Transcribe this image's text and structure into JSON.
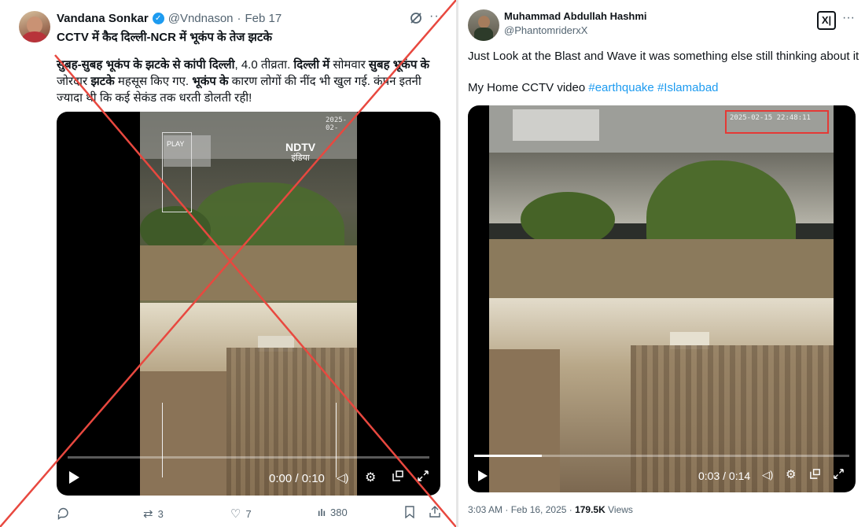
{
  "left_tweet": {
    "author_name": "Vandana Sonkar",
    "author_handle": "@Vndnason",
    "date": "Feb 17",
    "headline": "CCTV में कैद दिल्ली-NCR में भूकंप के तेज झटके",
    "body_segments": [
      {
        "text": "सुबह-सुबह भूकंप के झटके से कांपी दिल्ली",
        "bold": true
      },
      {
        "text": ", 4.0 तीव्रता. ",
        "bold": false
      },
      {
        "text": "दिल्ली में",
        "bold": true
      },
      {
        "text": " सोमवार ",
        "bold": false
      },
      {
        "text": "सुबह भूकंप के",
        "bold": true
      },
      {
        "text": " जोरदार ",
        "bold": false
      },
      {
        "text": "झटके",
        "bold": true
      },
      {
        "text": " महसूस किए गए. ",
        "bold": false
      },
      {
        "text": "भूकंप के",
        "bold": true
      },
      {
        "text": " कारण लोगों की नींद भी खुल गई. कंपन इतनी ज्यादा थी कि कई सेकंड तक धरती डोलती रही!",
        "bold": false
      }
    ],
    "video_time": "0:00 / 0:10",
    "video_overlay": {
      "play_label": "PLAY",
      "channel_logo": "NDTV",
      "channel_sub": "इंडिया",
      "timestamp": "2025-02-"
    },
    "actions": {
      "replies": "",
      "reposts": "3",
      "likes": "7",
      "views": "380"
    },
    "icons": [
      "verified-badge-icon",
      "grok-icon",
      "more-icon",
      "play-icon",
      "volume-icon",
      "settings-icon",
      "pip-icon",
      "fullscreen-icon",
      "reply-icon",
      "repost-icon",
      "like-icon",
      "views-icon",
      "bookmark-icon",
      "share-icon"
    ]
  },
  "right_tweet": {
    "author_name": "Muhammad Abdullah Hashmi",
    "author_handle": "@PhantomriderxX",
    "text_line1": "Just Look at the Blast and Wave it was something else still thinking about it",
    "text_line2_prefix": "My Home CCTV video ",
    "hashtags": [
      "#earthquake",
      "#Islamabad"
    ],
    "video_time": "0:03 / 0:14",
    "cctv_timestamp": "2025-02-15 22:48:11",
    "footer_time": "3:03 AM · Feb 16, 2025 · ",
    "views_count": "179.5K",
    "views_label": " Views",
    "icons": [
      "x-logo-icon",
      "more-icon",
      "play-icon",
      "volume-icon",
      "settings-icon",
      "pip-icon",
      "fullscreen-icon"
    ]
  },
  "colors": {
    "cross": "#e8483f",
    "link": "#1d9bf0",
    "verified": "#1d9bf0",
    "highlight_box": "#e53935",
    "text": "#0f1419",
    "muted": "#536471"
  }
}
